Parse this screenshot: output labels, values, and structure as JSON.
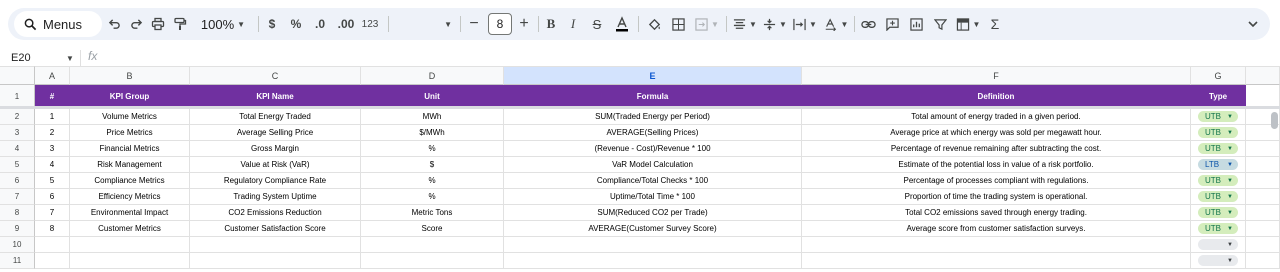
{
  "toolbar": {
    "menus_label": "Menus",
    "zoom_label": "100%",
    "currency_label": "$",
    "percent_label": "%",
    "decrease_decimals_label": ".0",
    "increase_decimals_label": ".00",
    "number_format_label": "123",
    "font_size_value": "8"
  },
  "formula_bar": {
    "name_box": "E20",
    "fx_label": "fx",
    "content": ""
  },
  "grid": {
    "column_letters": [
      "A",
      "B",
      "C",
      "D",
      "E",
      "F",
      "G"
    ],
    "selected_column": "E",
    "row_numbers": [
      "1",
      "2",
      "3",
      "4",
      "5",
      "6",
      "7",
      "8",
      "9",
      "10",
      "11"
    ],
    "header_row": [
      "#",
      "KPI Group",
      "KPI Name",
      "Unit",
      "Formula",
      "Definition",
      "Type"
    ],
    "rows": [
      [
        "1",
        "Volume Metrics",
        "Total Energy Traded",
        "MWh",
        "SUM(Traded Energy per Period)",
        "Total amount of energy traded in a given period.",
        "UTB"
      ],
      [
        "2",
        "Price Metrics",
        "Average Selling Price",
        "$/MWh",
        "AVERAGE(Selling Prices)",
        "Average price at which energy was sold per megawatt hour.",
        "UTB"
      ],
      [
        "3",
        "Financial Metrics",
        "Gross Margin",
        "%",
        "(Revenue - Cost)/Revenue * 100",
        "Percentage of revenue remaining after subtracting the cost.",
        "UTB"
      ],
      [
        "4",
        "Risk Management",
        "Value at Risk (VaR)",
        "$",
        "VaR Model Calculation",
        "Estimate of the potential loss in value of a risk portfolio.",
        "LTB"
      ],
      [
        "5",
        "Compliance Metrics",
        "Regulatory Compliance Rate",
        "%",
        "Compliance/Total Checks * 100",
        "Percentage of processes compliant with regulations.",
        "UTB"
      ],
      [
        "6",
        "Efficiency Metrics",
        "Trading System Uptime",
        "%",
        "Uptime/Total Time * 100",
        "Proportion of time the trading system is operational.",
        "UTB"
      ],
      [
        "7",
        "Environmental Impact",
        "CO2 Emissions Reduction",
        "Metric Tons",
        "SUM(Reduced CO2 per Trade)",
        "Total CO2 emissions saved through energy trading.",
        "UTB"
      ],
      [
        "8",
        "Customer Metrics",
        "Customer Satisfaction Score",
        "Score",
        "AVERAGE(Customer Survey Score)",
        "Average score from customer satisfaction surveys.",
        "UTB"
      ]
    ],
    "chip_colors": {
      "UTB": {
        "bg": "#d4edbc",
        "fg": "#11734b"
      },
      "LTB": {
        "bg": "#c6dbe1",
        "fg": "#0a53a8"
      },
      "empty": {
        "bg": "#e8eaed",
        "fg": "#3c4043"
      }
    },
    "header_color": "#7030a0"
  }
}
